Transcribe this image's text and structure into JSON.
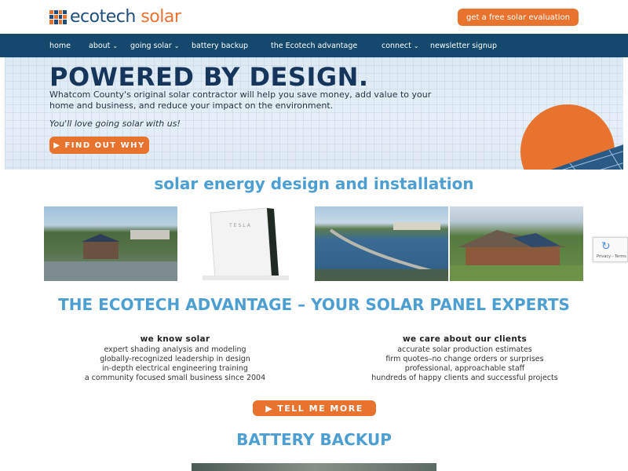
{
  "brand": {
    "name_part1": "ecotech",
    "name_part2": "solar"
  },
  "header": {
    "cta_label": "get a free solar evaluation"
  },
  "nav": {
    "items": [
      {
        "label": "home",
        "dropdown": false
      },
      {
        "label": "about",
        "dropdown": true
      },
      {
        "label": "going solar",
        "dropdown": true
      },
      {
        "label": "battery backup",
        "dropdown": false
      },
      {
        "label": "the Ecotech advantage",
        "dropdown": false
      },
      {
        "label": "connect",
        "dropdown": true
      },
      {
        "label": "newsletter signup",
        "dropdown": false
      }
    ]
  },
  "hero": {
    "title": "POWERED BY DESIGN.",
    "text": "Whatcom County's original solar contractor will help you save money, add value to your home and business, and reduce your impact on the environment.",
    "tagline": "You'll love going solar with us!",
    "button_label": "FIND OUT WHY"
  },
  "sections": {
    "solar_heading": "solar energy design and installation",
    "advantage_heading": "THE ECOTECH ADVANTAGE – YOUR SOLAR PANEL EXPERTS",
    "battery_heading": "BATTERY BACKUP"
  },
  "photos": {
    "tesla_label": "TESLA"
  },
  "recaptcha": {
    "text": "Privacy - Terms"
  },
  "advantage": {
    "left": {
      "heading": "we know solar",
      "items": [
        "expert shading analysis and modeling",
        "globally-recognized leadership in design",
        "in-depth electrical engineering training",
        "a community focused small business since 2004"
      ]
    },
    "right": {
      "heading": "we care about our clients",
      "items": [
        "accurate solar production estimates",
        "firm quotes–no change orders or surprises",
        "professional, approachable staff",
        "hundreds of happy clients and successful projects"
      ]
    },
    "button_label": "TELL ME MORE"
  },
  "colors": {
    "accent": "#e8732e",
    "navy": "#14486c",
    "heading_blue": "#4d9fd2"
  }
}
